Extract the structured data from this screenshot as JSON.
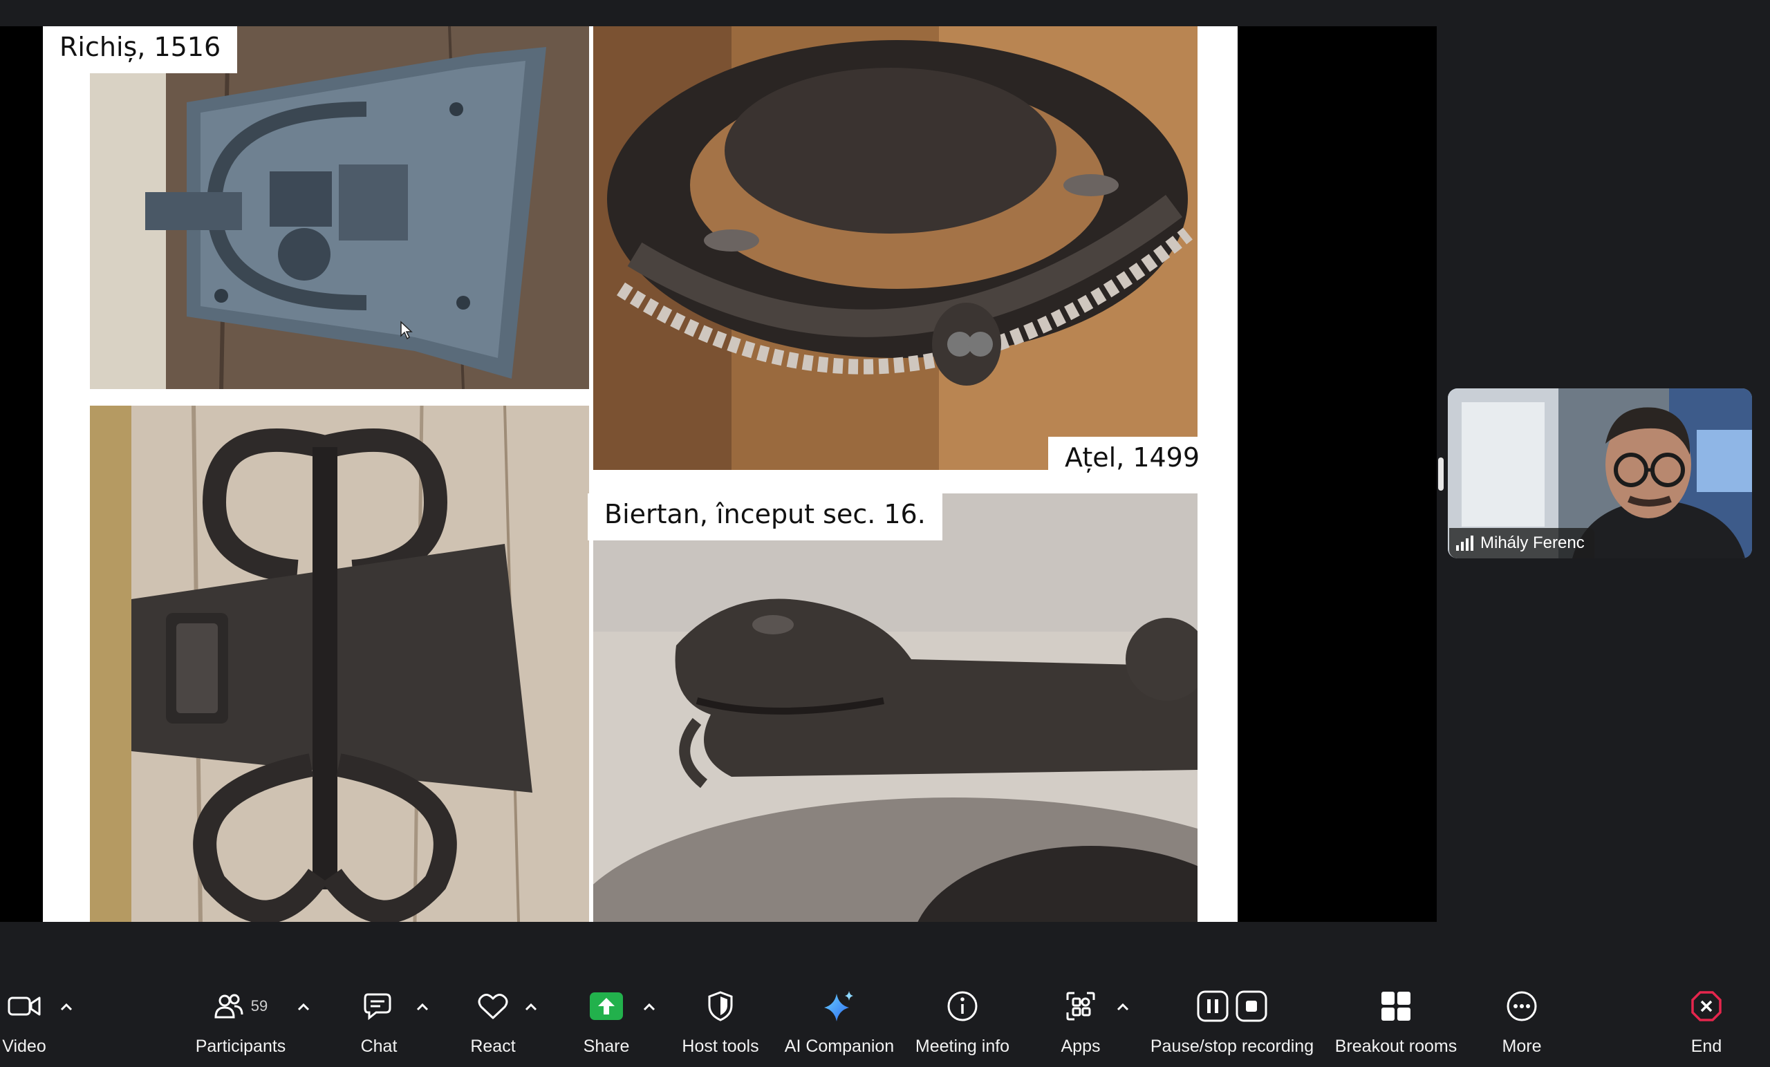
{
  "slide": {
    "captions": {
      "richis": "Richiș, 1516",
      "atel": "Ațel, 1499",
      "biertan": "Biertan, început sec. 16."
    }
  },
  "participant": {
    "name": "Mihály Ferenc"
  },
  "toolbar": {
    "video": "Video",
    "participants": "Participants",
    "participants_count": "59",
    "chat": "Chat",
    "react": "React",
    "share": "Share",
    "host_tools": "Host tools",
    "ai_companion": "AI Companion",
    "meeting_info": "Meeting info",
    "apps": "Apps",
    "recording": "Pause/stop recording",
    "breakout": "Breakout rooms",
    "more": "More",
    "end": "End"
  },
  "colors": {
    "share_green": "#22b14c",
    "end_red": "#e5264d",
    "toolbar_bg": "#1b1c1f"
  }
}
